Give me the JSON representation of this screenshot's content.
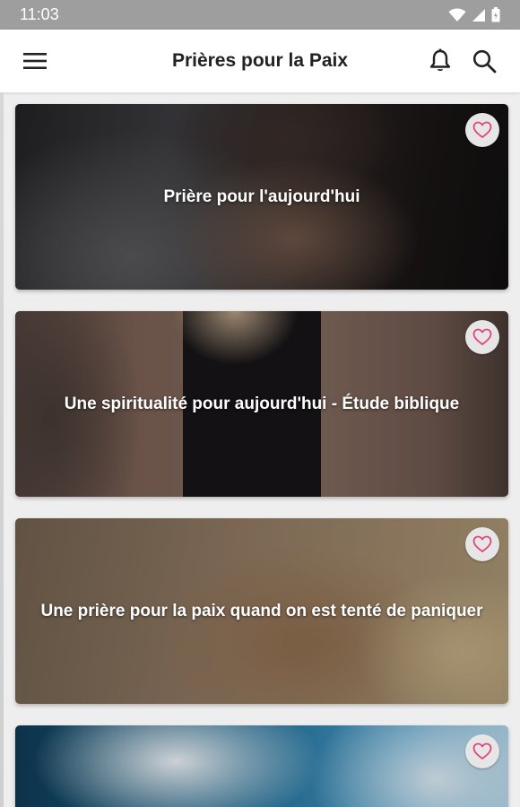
{
  "status_bar": {
    "time": "11:03"
  },
  "app_bar": {
    "title": "Prières pour la Paix",
    "icons": [
      "menu-icon",
      "bell-icon",
      "search-icon"
    ]
  },
  "cards": [
    {
      "title": "Prière pour l'aujourd'hui",
      "favorite_icon": "heart-outline-icon"
    },
    {
      "title": "Une spiritualité pour aujourd'hui - Étude biblique",
      "favorite_icon": "heart-outline-icon"
    },
    {
      "title": "Une prière pour la paix quand on est tenté de paniquer",
      "favorite_icon": "heart-outline-icon"
    },
    {
      "title": "",
      "favorite_icon": "heart-outline-icon"
    }
  ],
  "colors": {
    "status_bar": "#9e9e9e",
    "app_bar": "#ffffff",
    "heart": "#e0457b",
    "background": "#eeeeee"
  }
}
